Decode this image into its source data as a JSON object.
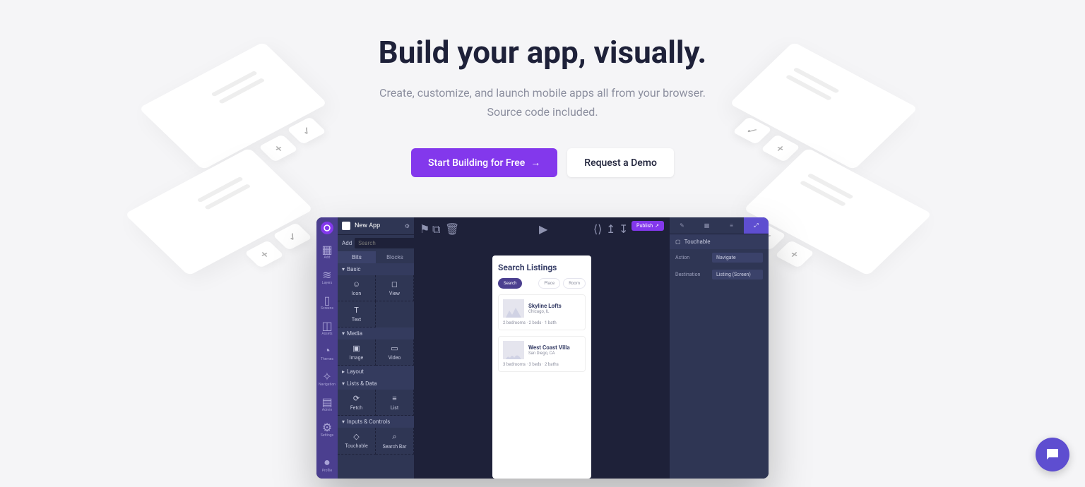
{
  "hero": {
    "title": "Build your app, visually.",
    "subtitle1": "Create, customize, and launch mobile apps all from your browser.",
    "subtitle2": "Source code included.",
    "cta_primary": "Start Building for Free",
    "cta_secondary": "Request a Demo"
  },
  "editor": {
    "app_name": "New App",
    "rail_items": [
      "Add",
      "Layers",
      "Screens",
      "Assets",
      "Themes",
      "Navigation",
      "Admin",
      "Settings",
      "Profile"
    ],
    "left": {
      "search_label": "Add",
      "search_placeholder": "Search",
      "tabs": [
        "Bits",
        "Blocks"
      ],
      "sections": {
        "basic": "Basic",
        "media": "Media",
        "layout": "Layout",
        "lists": "Lists & Data",
        "inputs": "Inputs & Controls"
      },
      "basic_items": [
        "Icon",
        "View",
        "Text"
      ],
      "media_items": [
        "Image",
        "Video"
      ],
      "lists_items": [
        "Fetch",
        "List"
      ],
      "inputs_items": [
        "Touchable",
        "Search Bar"
      ]
    },
    "topbar": {
      "publish": "Publish"
    },
    "phone": {
      "title": "Search Listings",
      "chips": [
        "Search",
        "Place",
        "Room"
      ],
      "cards": [
        {
          "title": "Skyline Lofts",
          "sub": "Chicago, IL",
          "meta": "2 bedrooms · 2 beds · 1 bath"
        },
        {
          "title": "West Coast Villa",
          "sub": "San Diego, CA",
          "meta": "3 bedrooms · 3 beds · 2 baths"
        }
      ]
    },
    "right": {
      "header": "Touchable",
      "rows": [
        {
          "k": "Action",
          "v": "Navigate"
        },
        {
          "k": "Destination",
          "v": "Listing (Screen)"
        }
      ]
    }
  }
}
